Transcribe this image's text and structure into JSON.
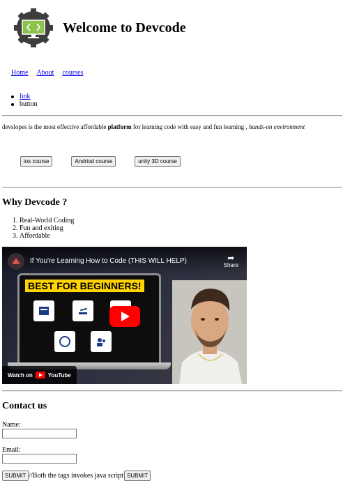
{
  "header": {
    "title": "Welcome to Devcode",
    "logo_icon": "code-screen-gear-icon"
  },
  "nav": {
    "items": [
      "Home",
      "About",
      "courses"
    ]
  },
  "bullets": {
    "link": "link",
    "button": "button"
  },
  "intro": {
    "text_start": "devslopes is the most effective affordable ",
    "text_bold": "platform",
    "text_mid": " for learning code with easy and fun learning , ",
    "text_italic": "hands-on environment"
  },
  "courses": [
    "ios course",
    "Andriod course",
    "unity 3D course"
  ],
  "why": {
    "heading": "Why Devcode ?",
    "reasons": [
      "Real-World Coding",
      "Fun and exiting",
      "Affordable"
    ]
  },
  "video": {
    "title": "If You're Learning How to Code (THIS WILL HELP)",
    "share_label": "Share",
    "banner": "BEST FOR BEGINNERS!",
    "watch_on": "Watch on",
    "youtube_label": "YouTube"
  },
  "contact": {
    "heading": "Contact us",
    "name_label": "Name:",
    "email_label": "Email:",
    "submit_label": "SUBMIT",
    "note": "//Both the tags invokes java script",
    "submit2_label": "SUBMIT"
  }
}
